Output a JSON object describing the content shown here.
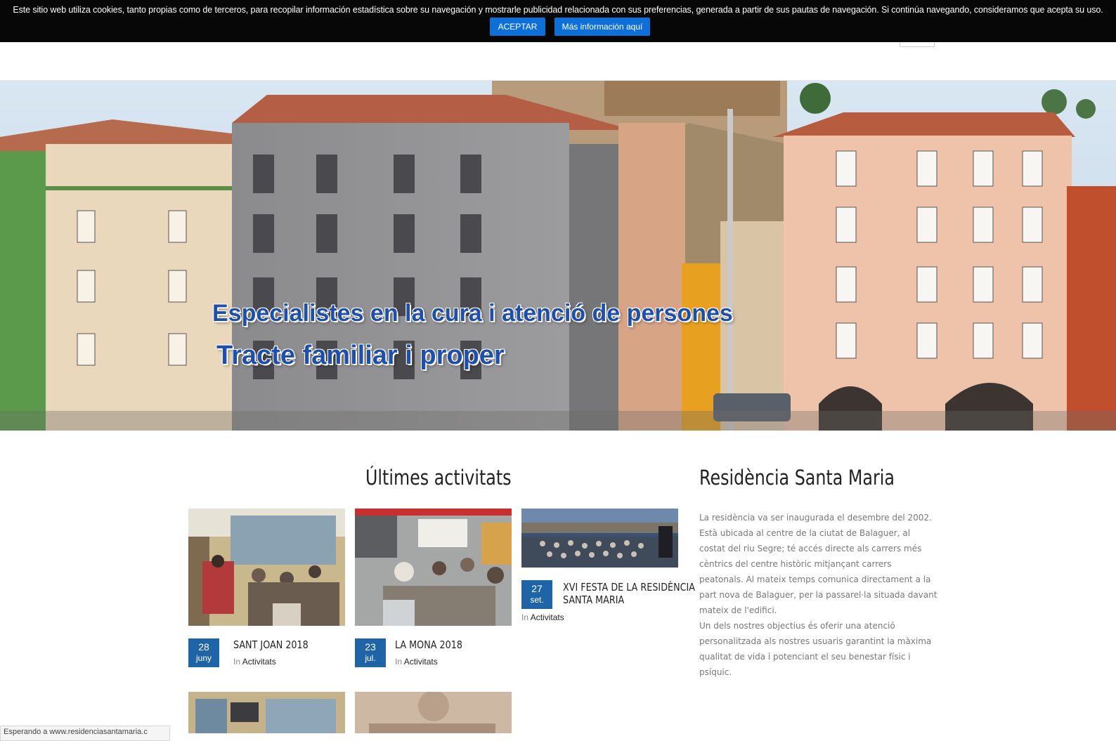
{
  "cookie": {
    "message": "Este sitio web utiliza cookies, tanto propias como de terceros, para recopilar información estadística sobre su navegación y mostrarle publicidad relacionada con sus preferencias, generada a partir de sus pautas de navegación. Si continúa navegando, consideramos que acepta su uso.",
    "accept_label": "ACEPTAR",
    "info_label": "Más información aquí",
    "accent": "#0d6fd8"
  },
  "hero": {
    "line1": "Especialistes en la cura i atenció de persones",
    "line2": "Tracte familiar i proper",
    "text_color": "#1f4fa8"
  },
  "activities": {
    "title": "Últimes activitats",
    "category_prefix": "In",
    "cards": [
      {
        "day": "28",
        "month": "juny",
        "title": "SANT JOAN 2018",
        "category": "Activitats"
      },
      {
        "day": "23",
        "month": "jul.",
        "title": "LA MONA 2018",
        "category": "Activitats"
      },
      {
        "day": "27",
        "month": "set.",
        "title_line1": "XVI FESTA DE LA RESIDÈNCIA",
        "title_line2": "SANTA MARIA",
        "category": "Activitats"
      }
    ],
    "badge_color": "#1e64a6"
  },
  "residence": {
    "title": "Residència Santa Maria",
    "paragraph1": "La residència va ser inaugurada el desembre del 2002. Està ubicada al centre de la ciutat de Balaguer, al costat del riu Segre; té accés directe als carrers més cèntrics del centre històric mitjançant carrers peatonals. Al mateix temps comunica directament a la part nova de Balaguer, per la passarel·la situada davant mateix de l'edifici.",
    "paragraph2": "Un dels nostres objectius és oferir una atenció personalitzada als nostres usuaris garantint la màxima qualitat de vida i potenciant el seu benestar físic i psíquic."
  },
  "status_bar": {
    "text": "Esperando a www.residenciasantamaria.c"
  }
}
